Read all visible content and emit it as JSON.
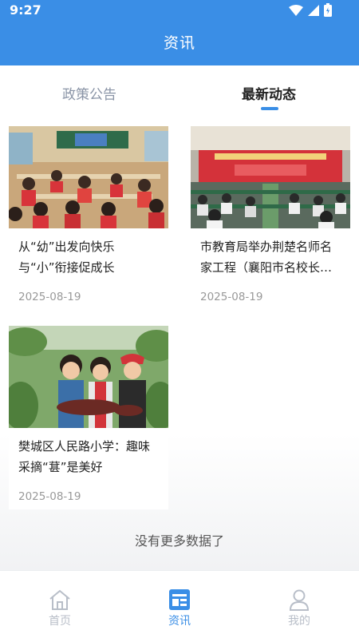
{
  "status": {
    "time": "9:27"
  },
  "header": {
    "title": "资讯"
  },
  "tabs": [
    {
      "label": "政策公告",
      "active": false
    },
    {
      "label": "最新动态",
      "active": true
    }
  ],
  "articles": [
    {
      "title": "从“幼”出发向快乐 与“小”衔接促成长",
      "date": "2025-08-19",
      "image": "classroom-children-photo"
    },
    {
      "title": "市教育局举办荆楚名师名家工程（襄阳市名校长…",
      "date": "2025-08-19",
      "image": "conference-hall-photo"
    },
    {
      "title": "樊城区人民路小学：趣味采摘“葚”是美好",
      "date": "2025-08-19",
      "image": "children-picking-mulberries-photo"
    }
  ],
  "footer_note": "没有更多数据了",
  "bottom_nav": [
    {
      "label": "首页",
      "icon": "home-icon",
      "active": false
    },
    {
      "label": "资讯",
      "icon": "news-icon",
      "active": true
    },
    {
      "label": "我的",
      "icon": "profile-icon",
      "active": false
    }
  ],
  "colors": {
    "brand": "#3a8ee6",
    "inactive": "#b8bec8",
    "text": "#222222",
    "muted": "#999999"
  }
}
